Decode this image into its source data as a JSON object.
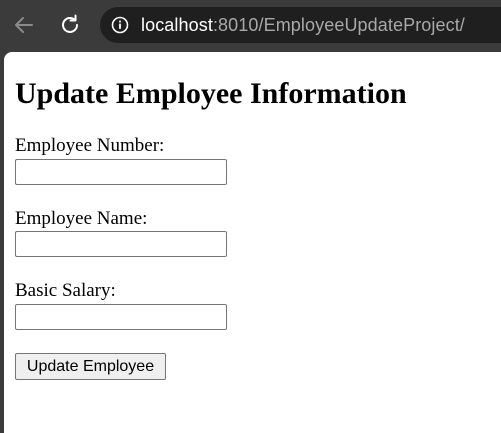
{
  "browser": {
    "url_host": "localhost",
    "url_path": ":8010/EmployeeUpdateProject/"
  },
  "page": {
    "title": "Update Employee Information",
    "form": {
      "employee_number_label": "Employee Number:",
      "employee_number_value": "",
      "employee_name_label": "Employee Name:",
      "employee_name_value": "",
      "basic_salary_label": "Basic Salary:",
      "basic_salary_value": "",
      "submit_label": "Update Employee"
    }
  },
  "icons": {
    "back": "back-arrow-icon",
    "reload": "reload-icon",
    "info": "info-icon"
  },
  "colors": {
    "browser_chrome": "#3b3b3b",
    "address_bar": "#1f1f1f",
    "page_background": "#ffffff"
  }
}
